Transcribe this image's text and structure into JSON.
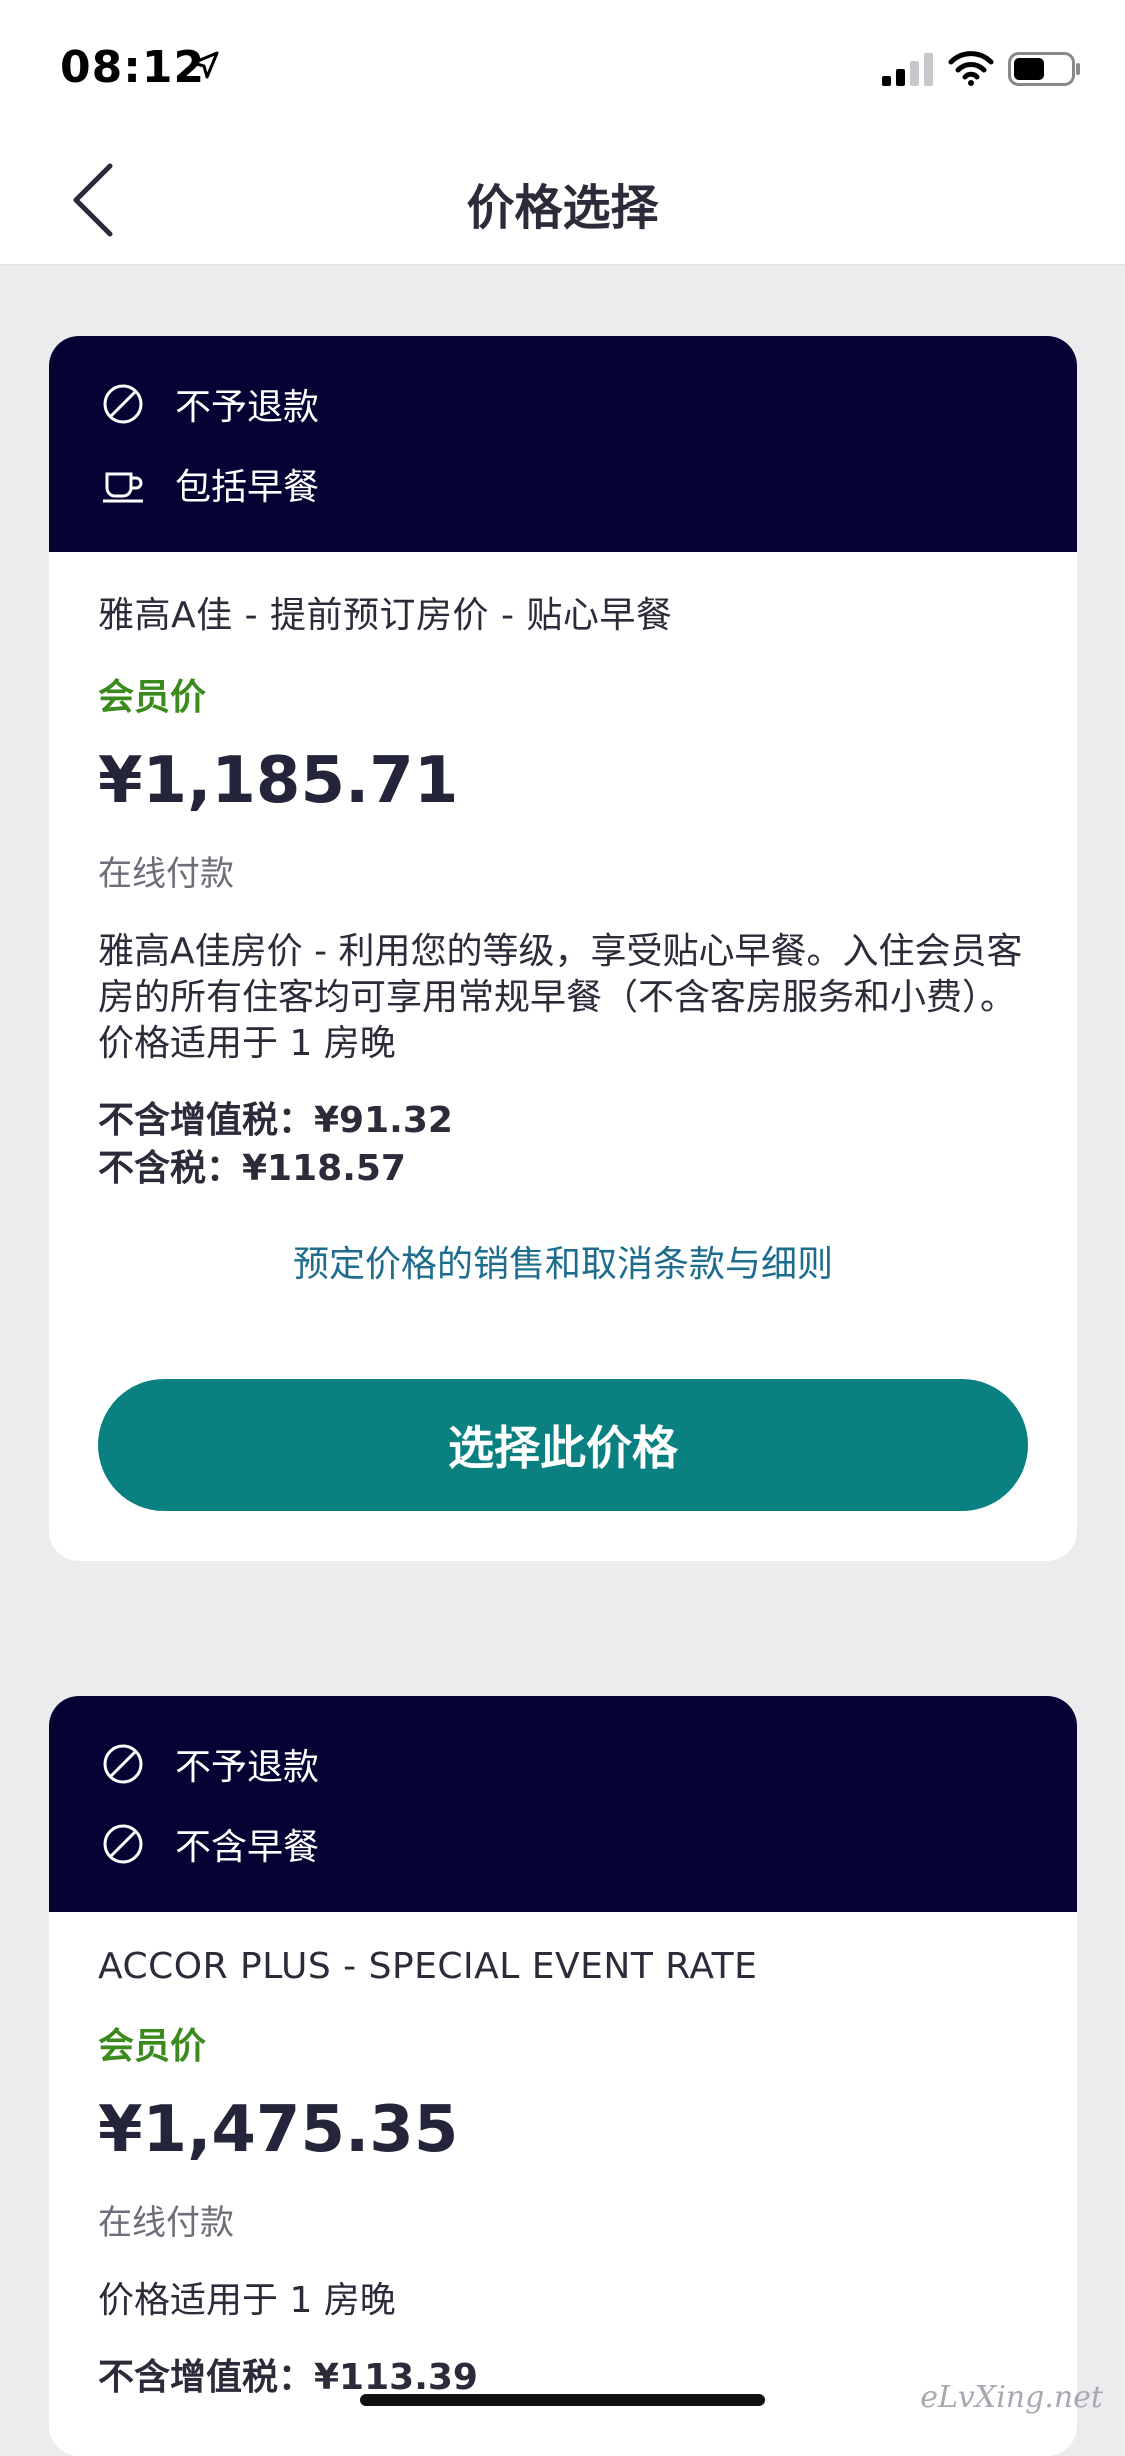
{
  "status_bar": {
    "time": "08:12"
  },
  "nav": {
    "title": "价格选择"
  },
  "cards": [
    {
      "features": [
        "不予退款",
        "包括早餐"
      ],
      "rate_name": "雅高A佳 - 提前预订房价 - 贴心早餐",
      "member_label": "会员价",
      "price": "¥1,185.71",
      "payment": "在线付款",
      "description": "雅高A佳房价 - 利用您的等级，享受贴心早餐。入住会员客房的所有住客均可享用常规早餐（不含客房服务和小费）。",
      "nights": "价格适用于 1 房晚",
      "tax_excl_vat": "不含增值税：¥91.32",
      "tax_excl": "不含税：¥118.57",
      "terms_link": "预定价格的销售和取消条款与细则",
      "select_button": "选择此价格"
    },
    {
      "features": [
        "不予退款",
        "不含早餐"
      ],
      "rate_name": "ACCOR PLUS - SPECIAL EVENT RATE",
      "member_label": "会员价",
      "price": "¥1,475.35",
      "payment": "在线付款",
      "nights": "价格适用于 1 房晚",
      "tax_excl_vat": "不含增值税：¥113.39"
    }
  ],
  "watermark": "eLvXing.net",
  "icons": {
    "no_refund": "prohibited-icon",
    "breakfast": "coffee-cup-icon",
    "no_breakfast": "prohibited-icon"
  },
  "colors": {
    "card_header": "#050333",
    "member_green": "#3B8A1D",
    "button_teal": "#0A8080",
    "link_blue": "#1E6C8E"
  }
}
